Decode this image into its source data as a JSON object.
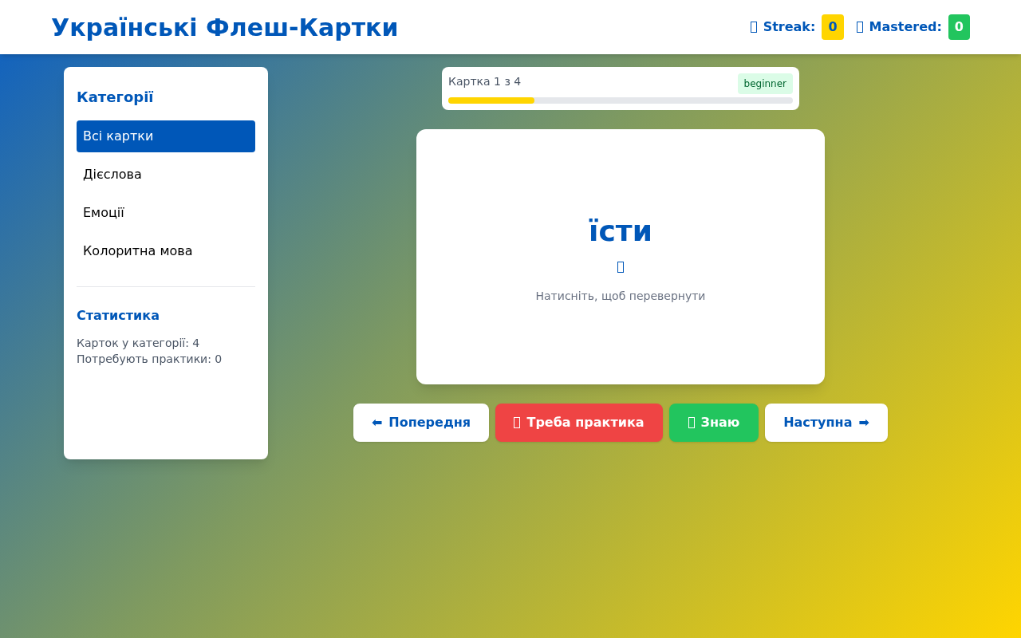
{
  "header": {
    "title": "Українські Флеш-Картки",
    "stats": [
      {
        "label": "Streak:",
        "value": "0",
        "color": "#ffd500"
      },
      {
        "label": "Mastered:",
        "value": "0",
        "color": "#22c55e"
      }
    ]
  },
  "sidebar": {
    "title": "Категорії",
    "items": [
      {
        "label": "Всі картки",
        "selected": true
      },
      {
        "label": "Дієслова",
        "selected": false
      },
      {
        "label": "Емоції",
        "selected": false
      },
      {
        "label": "Колоритна мова",
        "selected": false
      }
    ],
    "stats_title": "Статистика",
    "stats": [
      "Карток у категорії: 4",
      "Потребують практики: 0"
    ]
  },
  "progress": {
    "label": "Картка 1 з 4",
    "level_tag": "beginner",
    "level": 0.25
  },
  "card": {
    "word": "їсти",
    "hint": "Натисніть, щоб перевернути"
  },
  "buttons": [
    {
      "kind": "prev",
      "label": "Попередня",
      "arrow": "⬅"
    },
    {
      "kind": "practice",
      "label": "Треба практика"
    },
    {
      "kind": "know",
      "label": "Знаю"
    },
    {
      "kind": "next",
      "label": "Наступна",
      "arrow": "➡"
    }
  ]
}
